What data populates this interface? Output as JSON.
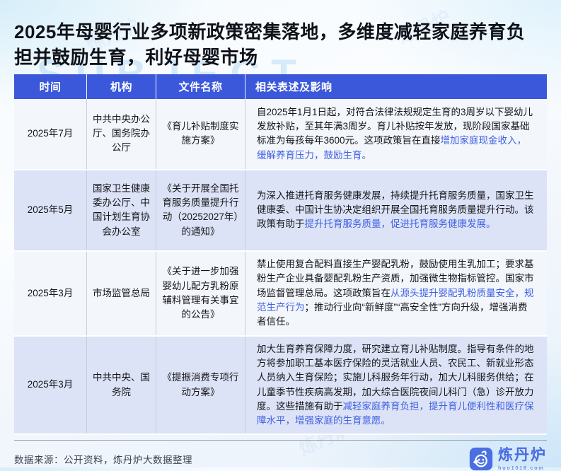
{
  "page": {
    "title": "2025年母婴行业多项新政策密集落地，多维度减轻家庭养育负担并鼓励生育，利好母婴市场",
    "watermark_word": "SUBJECT",
    "watermark_brand": "炼丹炉",
    "source_note": "数据来源：公开资料，炼丹炉大数据整理",
    "brand": {
      "name": "炼丹炉",
      "url": "huo1018.com"
    },
    "colors": {
      "header_blue": "#3b57da",
      "highlight_blue": "#4062e3",
      "row_light": "#f3f6fb",
      "row_alt": "#dde3f6"
    }
  },
  "table": {
    "headers": [
      "时间",
      "机构",
      "文件名称",
      "相关表述及影响"
    ],
    "rows": [
      {
        "time": "2025年7月",
        "org": "中共中央办公厅、国务院办公厅",
        "doc": "《育儿补贴制度实施方案》",
        "content": [
          {
            "t": "自2025年1月1日起，对符合法律法规规定生育的3周岁以下婴幼儿发放补贴，至其年满3周岁。育儿补贴按年发放，现阶段国家基础标准为每孩每年3600元。这项政策旨在直接",
            "hl": false
          },
          {
            "t": "增加家庭现金收入，缓解养育压力，鼓励生育。",
            "hl": true
          }
        ]
      },
      {
        "time": "2025年5月",
        "org": "国家卫生健康委办公厅、中国计划生育协会办公室",
        "doc": "《关于开展全国托育服务质量提升行动（20252027年）的通知》",
        "content": [
          {
            "t": "为深入推进托育服务健康发展，持续提升托育服务质量，国家卫生健康委、中国计生协决定组织开展全国托育服务质量提升行动。该政策有助于",
            "hl": false
          },
          {
            "t": "提升托育服务质量，促进托育服务健康发展。",
            "hl": true
          }
        ]
      },
      {
        "time": "2025年3月",
        "org": "市场监管总局",
        "doc": "《关于进一步加强婴幼儿配方乳粉原辅料管理有关事宜的公告》",
        "content": [
          {
            "t": "禁止使用复合配料直接生产婴配乳粉，鼓励使用生乳加工；要求基粉生产企业具备婴配乳粉生产资质，加强微生物指标管控。国家市场监督管理总局。这项政策旨在",
            "hl": false
          },
          {
            "t": "从源头提升婴配乳粉质量安全，规范生产行为",
            "hl": true
          },
          {
            "t": "；推动行业向“新鲜度”“高安全性”方向升级，增强消费者信任。",
            "hl": false
          }
        ]
      },
      {
        "time": "2025年3月",
        "org": "中共中央、国务院",
        "doc": "《提振消费专项行动方案》",
        "content": [
          {
            "t": "加大生育养育保障力度，研究建立育儿补贴制度。指导有条件的地方将参加职工基本医疗保险的灵活就业人员、农民工、新就业形态人员纳入生育保险；实施儿科服务年行动，加大儿科服务供给；在儿童季节性疾病高发期，加大综合医院夜间儿科门（急）诊开放力度。这些措施有助于",
            "hl": false
          },
          {
            "t": "减轻家庭养育负担，提升育儿便利性和医疗保障水平，增强家庭的生育意愿。",
            "hl": true
          }
        ]
      }
    ]
  }
}
